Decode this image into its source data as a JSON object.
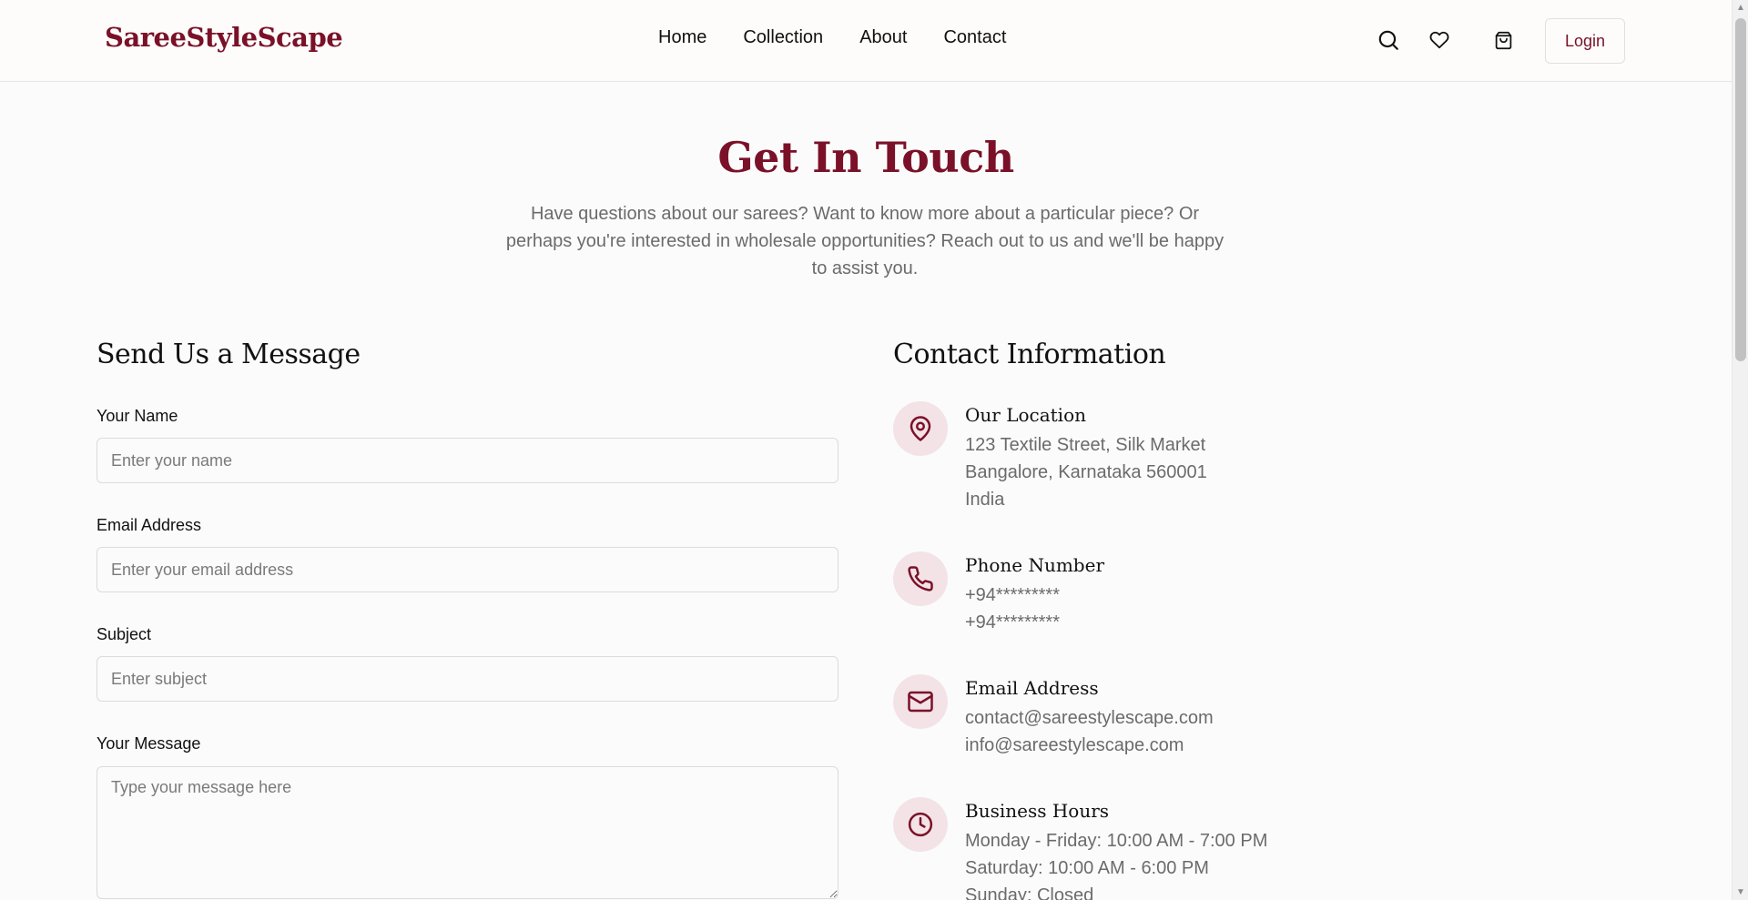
{
  "brand": {
    "name": "SareeStyleScape",
    "accent": "#7a1128"
  },
  "nav": {
    "items": [
      {
        "label": "Home"
      },
      {
        "label": "Collection"
      },
      {
        "label": "About"
      },
      {
        "label": "Contact"
      }
    ]
  },
  "header": {
    "icons": [
      "search-icon",
      "heart-icon",
      "shopping-bag-icon"
    ],
    "login_label": "Login"
  },
  "hero": {
    "title": "Get In Touch",
    "subtitle": "Have questions about our sarees? Want to know more about a particular piece? Or perhaps you're interested in wholesale opportunities? Reach out to us and we'll be happy to assist you."
  },
  "form": {
    "heading": "Send Us a Message",
    "fields": [
      {
        "label": "Your Name",
        "placeholder": "Enter your name",
        "value": ""
      },
      {
        "label": "Email Address",
        "placeholder": "Enter your email address",
        "value": ""
      },
      {
        "label": "Subject",
        "placeholder": "Enter subject",
        "value": ""
      },
      {
        "label": "Your Message",
        "placeholder": "Type your message here",
        "value": ""
      }
    ]
  },
  "contact": {
    "heading": "Contact Information",
    "items": [
      {
        "icon": "map-pin-icon",
        "title": "Our Location",
        "lines": [
          "123 Textile Street, Silk Market",
          "Bangalore, Karnataka 560001",
          "India"
        ]
      },
      {
        "icon": "phone-icon",
        "title": "Phone Number",
        "lines": [
          "+94*********",
          "+94*********"
        ]
      },
      {
        "icon": "mail-icon",
        "title": "Email Address",
        "lines": [
          "contact@sareestylescape.com",
          "info@sareestylescape.com"
        ]
      },
      {
        "icon": "clock-icon",
        "title": "Business Hours",
        "lines": [
          "Monday - Friday: 10:00 AM - 7:00 PM",
          "Saturday: 10:00 AM - 6:00 PM",
          "Sunday: Closed"
        ]
      }
    ]
  }
}
